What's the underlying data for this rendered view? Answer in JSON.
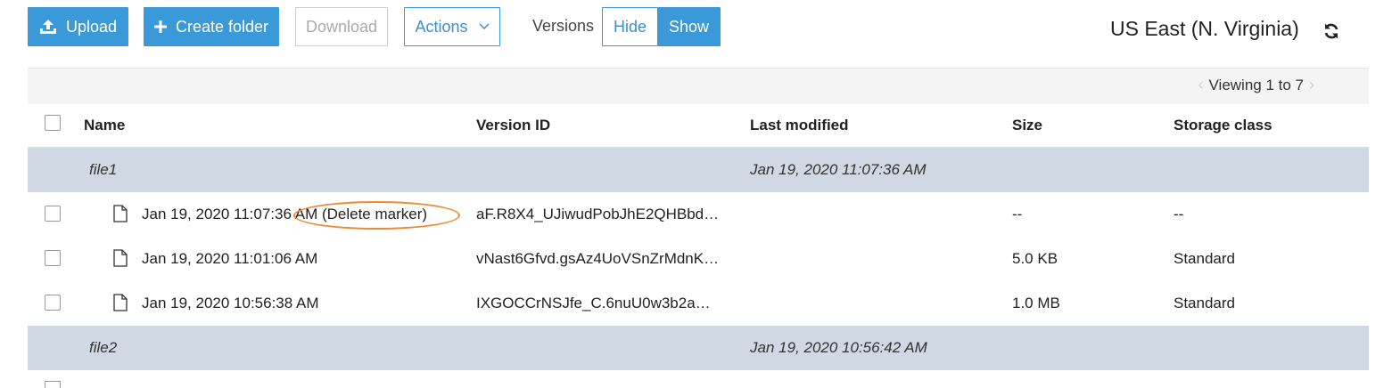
{
  "toolbar": {
    "upload_label": "Upload",
    "create_folder_label": "Create folder",
    "download_label": "Download",
    "actions_label": "Actions",
    "versions_label": "Versions",
    "hide_label": "Hide",
    "show_label": "Show",
    "region": "US East (N. Virginia)"
  },
  "pager": {
    "text": "Viewing 1 to 7"
  },
  "table": {
    "columns": [
      "Name",
      "Version ID",
      "Last modified",
      "Size",
      "Storage class"
    ],
    "groups": [
      {
        "name": "file1",
        "last_modified": "Jan 19, 2020 11:07:36 AM",
        "versions": [
          {
            "name": "Jan 19, 2020 11:07:36 AM (Delete marker)",
            "version_id": "aF.R8X4_UJiwudPobJhE2QHBbd…",
            "size": "--",
            "storage_class": "--"
          },
          {
            "name": "Jan 19, 2020 11:01:06 AM",
            "version_id": "vNast6Gfvd.gsAz4UoVSnZrMdnK…",
            "size": "5.0 KB",
            "storage_class": "Standard"
          },
          {
            "name": "Jan 19, 2020 10:56:38 AM",
            "version_id": "IXGOCCrNSJfe_C.6nuU0w3b2a…",
            "size": "1.0 MB",
            "storage_class": "Standard"
          }
        ]
      },
      {
        "name": "file2",
        "last_modified": "Jan 19, 2020 10:56:42 AM",
        "versions": []
      }
    ]
  },
  "colors": {
    "primary": "#3a99d8",
    "group_row": "#cfd8e3",
    "highlight_ellipse": "#ef8a34"
  }
}
